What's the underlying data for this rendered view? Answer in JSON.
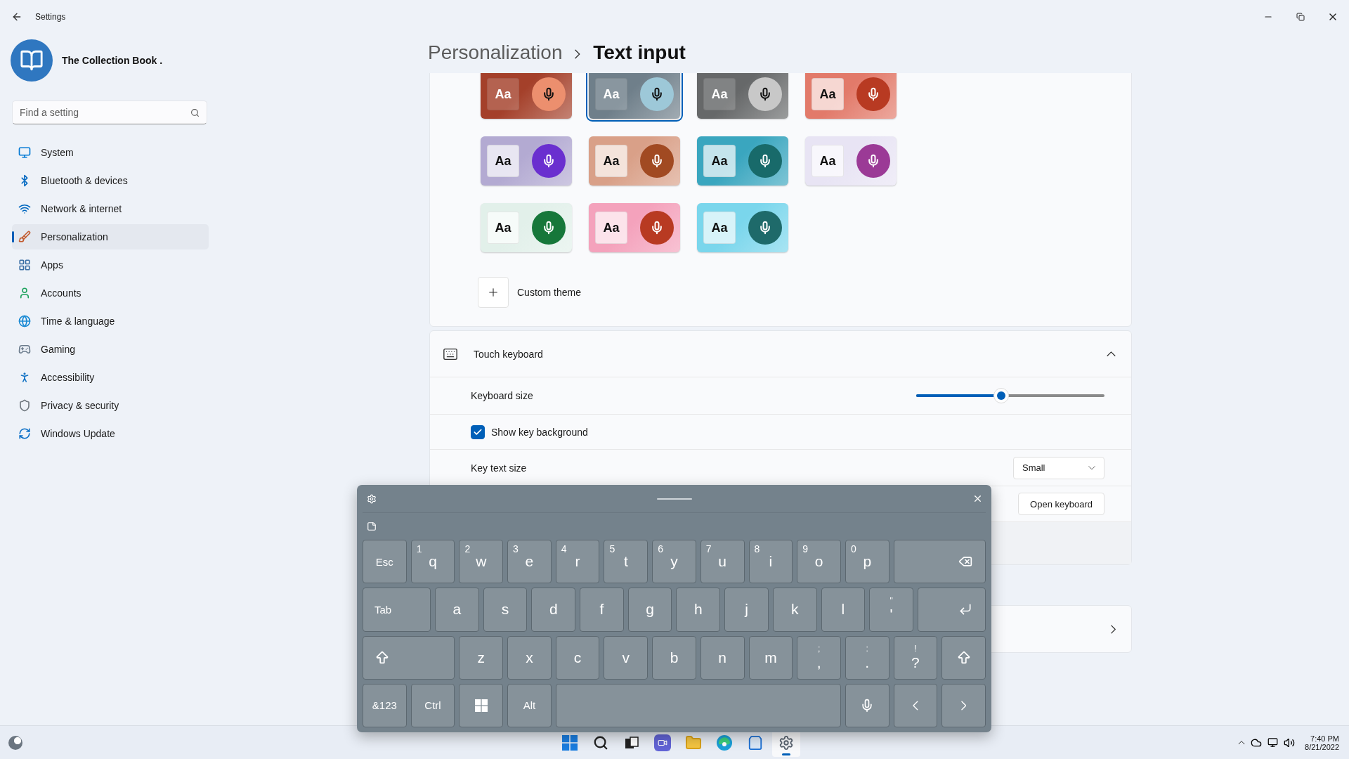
{
  "window": {
    "title": "Settings"
  },
  "profile": {
    "name": "The Collection Book ."
  },
  "search": {
    "placeholder": "Find a setting"
  },
  "nav": [
    {
      "label": "System",
      "kind": "system",
      "selected": false
    },
    {
      "label": "Bluetooth & devices",
      "kind": "bluetooth",
      "selected": false
    },
    {
      "label": "Network & internet",
      "kind": "network",
      "selected": false
    },
    {
      "label": "Personalization",
      "kind": "personalization",
      "selected": true
    },
    {
      "label": "Apps",
      "kind": "apps",
      "selected": false
    },
    {
      "label": "Accounts",
      "kind": "accounts",
      "selected": false
    },
    {
      "label": "Time & language",
      "kind": "time",
      "selected": false
    },
    {
      "label": "Gaming",
      "kind": "gaming",
      "selected": false
    },
    {
      "label": "Accessibility",
      "kind": "accessibility",
      "selected": false
    },
    {
      "label": "Privacy & security",
      "kind": "privacy",
      "selected": false
    },
    {
      "label": "Windows Update",
      "kind": "update",
      "selected": false
    }
  ],
  "breadcrumb": [
    "Personalization",
    "Text input"
  ],
  "themes": [
    {
      "label": "Aa",
      "color": "#ec8f6e",
      "selected": false
    },
    {
      "label": "Aa",
      "color": "#9dc8d8",
      "selected": true
    },
    {
      "label": "Aa",
      "color": "#c8c8c8",
      "selected": false
    },
    {
      "label": "Aa",
      "color": "#b83a22",
      "selected": false
    },
    {
      "label": "Aa",
      "color": "#6a2fcf",
      "selected": false
    },
    {
      "label": "Aa",
      "color": "#a14a22",
      "selected": false
    },
    {
      "label": "Aa",
      "color": "#186a6a",
      "selected": false
    },
    {
      "label": "Aa",
      "color": "#9b3a96",
      "selected": false
    },
    {
      "label": "Aa",
      "color": "#16773a",
      "selected": false
    },
    {
      "label": "Aa",
      "color": "#b83a22",
      "selected": false
    },
    {
      "label": "Aa",
      "color": "#1e6a6a",
      "selected": false
    }
  ],
  "custom_theme": {
    "label": "Custom theme"
  },
  "touch_keyboard": {
    "title": "Touch keyboard",
    "expanded": true,
    "keyboard_size": {
      "label": "Keyboard size",
      "level": 0.45
    },
    "key_background": {
      "label": "Show key background",
      "checked": true
    },
    "key_text_size": {
      "label": "Key text size",
      "value": "Small"
    },
    "open_keyboard": {
      "button": "Open keyboard"
    }
  },
  "keyboard": {
    "rows": [
      {
        "keys": [
          {
            "kind": "text",
            "label": "Esc"
          },
          {
            "kind": "char",
            "label": "q",
            "hint": "1"
          },
          {
            "kind": "char",
            "label": "w",
            "hint": "2"
          },
          {
            "kind": "char",
            "label": "e",
            "hint": "3"
          },
          {
            "kind": "char",
            "label": "r",
            "hint": "4"
          },
          {
            "kind": "char",
            "label": "t",
            "hint": "5"
          },
          {
            "kind": "char",
            "label": "y",
            "hint": "6"
          },
          {
            "kind": "char",
            "label": "u",
            "hint": "7"
          },
          {
            "kind": "char",
            "label": "i",
            "hint": "8"
          },
          {
            "kind": "char",
            "label": "o",
            "hint": "9"
          },
          {
            "kind": "char",
            "label": "p",
            "hint": "0"
          },
          {
            "kind": "backspace"
          }
        ]
      },
      {
        "keys": [
          {
            "kind": "tab",
            "label": "Tab"
          },
          {
            "kind": "char",
            "label": "a"
          },
          {
            "kind": "char",
            "label": "s"
          },
          {
            "kind": "char",
            "label": "d"
          },
          {
            "kind": "char",
            "label": "f"
          },
          {
            "kind": "char",
            "label": "g"
          },
          {
            "kind": "char",
            "label": "h"
          },
          {
            "kind": "char",
            "label": "j"
          },
          {
            "kind": "char",
            "label": "k"
          },
          {
            "kind": "char",
            "label": "l"
          },
          {
            "kind": "char",
            "label": "'",
            "top": "\""
          },
          {
            "kind": "enter"
          }
        ]
      },
      {
        "keys": [
          {
            "kind": "shift_left"
          },
          {
            "kind": "char",
            "label": "z"
          },
          {
            "kind": "char",
            "label": "x"
          },
          {
            "kind": "char",
            "label": "c"
          },
          {
            "kind": "char",
            "label": "v"
          },
          {
            "kind": "char",
            "label": "b"
          },
          {
            "kind": "char",
            "label": "n"
          },
          {
            "kind": "char",
            "label": "m"
          },
          {
            "kind": "char",
            "label": ",",
            "top": ";"
          },
          {
            "kind": "char",
            "label": ".",
            "top": ":"
          },
          {
            "kind": "char",
            "label": "?",
            "top": "!"
          },
          {
            "kind": "shift_right"
          }
        ]
      },
      {
        "keys": [
          {
            "kind": "text",
            "label": "&123"
          },
          {
            "kind": "text",
            "label": "Ctrl"
          },
          {
            "kind": "windows"
          },
          {
            "kind": "text",
            "label": "Alt"
          },
          {
            "kind": "space"
          },
          {
            "kind": "mic"
          },
          {
            "kind": "left"
          },
          {
            "kind": "right"
          }
        ]
      }
    ]
  },
  "taskbar": {
    "apps": [
      {
        "kind": "start",
        "selected": false
      },
      {
        "kind": "search",
        "selected": false
      },
      {
        "kind": "taskview",
        "selected": false
      },
      {
        "kind": "chat",
        "selected": false
      },
      {
        "kind": "explorer",
        "selected": false
      },
      {
        "kind": "edge",
        "selected": false
      },
      {
        "kind": "store",
        "selected": false
      },
      {
        "kind": "settings",
        "selected": true
      }
    ],
    "time": "7:40 PM",
    "date": "8/21/2022"
  }
}
